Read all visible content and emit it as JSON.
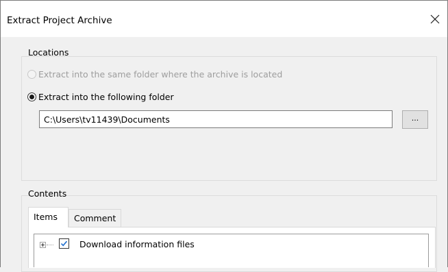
{
  "dialog": {
    "title": "Extract Project Archive",
    "close_icon": "close-icon"
  },
  "locations": {
    "legend": "Locations",
    "option_same_folder": {
      "label": "Extract into the same folder where the archive is located",
      "selected": false,
      "enabled": false
    },
    "option_following_folder": {
      "label": "Extract into the following folder",
      "selected": true,
      "enabled": true
    },
    "folder_path": "C:\\Users\\tv11439\\Documents",
    "browse_label": "..."
  },
  "contents": {
    "legend": "Contents",
    "tabs": [
      {
        "label": "Items",
        "active": true
      },
      {
        "label": "Comment",
        "active": false
      }
    ],
    "tree": {
      "items": [
        {
          "label": "Download information files",
          "checked": true,
          "expander_icon": "plus-expander-icon"
        }
      ]
    }
  },
  "colors": {
    "checkmark": "#1f6fcf",
    "disabled_text": "#9d9d9d",
    "window_bg": "#f0f0f0"
  }
}
